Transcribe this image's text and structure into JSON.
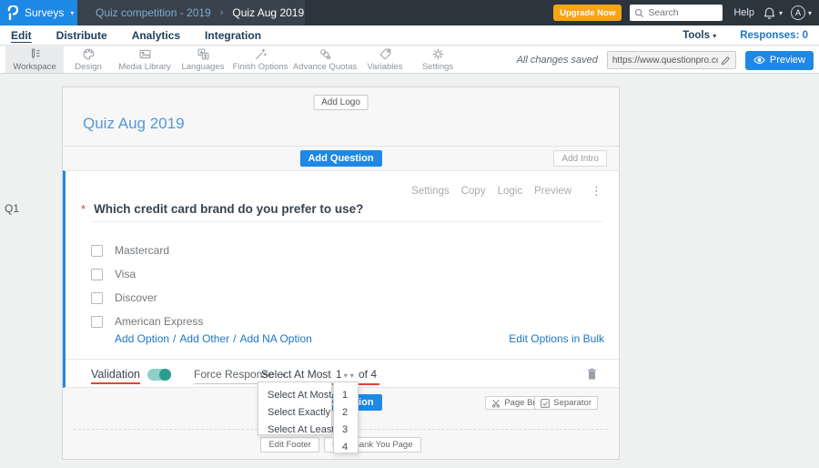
{
  "icons": {
    "caret_down": "▾",
    "more_vertical": "⋮",
    "breadcrumb_separator": "›",
    "link_separator": "/"
  },
  "colors": {
    "brand_blue": "#1e88e5",
    "upgrade_orange": "#f7a415",
    "toggle_teal": "#2a9d8f",
    "underline_red": "#e8432e"
  },
  "topbar": {
    "product_menu": "Surveys",
    "breadcrumb": {
      "parent": "Quiz competition - 2019",
      "current": "Quiz Aug 2019"
    },
    "upgrade_label": "Upgrade Now",
    "search_placeholder": "Search",
    "help_label": "Help",
    "avatar_initial": "A"
  },
  "nav": {
    "items": [
      "Edit",
      "Distribute",
      "Analytics",
      "Integration"
    ],
    "tools_label": "Tools",
    "responses_label": "Responses: 0"
  },
  "toolbar": {
    "items": [
      "Workspace",
      "Design",
      "Media Library",
      "Languages",
      "Finish Options",
      "Advance Quotas",
      "Variables",
      "Settings"
    ],
    "saved_status": "All changes saved",
    "url_value": "https://www.questionpro.com/t/APNrFZ",
    "preview_label": "Preview"
  },
  "survey": {
    "add_logo_label": "Add Logo",
    "title": "Quiz Aug 2019",
    "add_question_label": "Add Question",
    "add_intro_label": "Add Intro",
    "question_number": "Q1",
    "question": {
      "actions": [
        "Settings",
        "Copy",
        "Logic",
        "Preview"
      ],
      "required_marker": "*",
      "text": "Which credit card brand do you prefer to use?",
      "options": [
        "Mastercard",
        "Visa",
        "Discover",
        "American Express"
      ],
      "add_links": [
        "Add Option",
        "Add Other",
        "Add NA Option"
      ],
      "bulk_edit_label": "Edit Options in Bulk"
    },
    "validation": {
      "label": "Validation",
      "force_response_label": "Force Response",
      "rule_value": "Select At Most",
      "count_value": "1",
      "of_label": "of 4"
    },
    "footer": {
      "add_question_label": "Add Question",
      "page_break_label": "Page Break",
      "separator_label": "Separator",
      "edit_footer_label": "Edit Footer",
      "edit_thank_you_label": "Edit Thank You Page"
    }
  },
  "dropdowns": {
    "rule_options": [
      "Select At Most",
      "Select Exactly",
      "Select At Least"
    ],
    "count_options": [
      "1",
      "2",
      "3",
      "4"
    ]
  }
}
